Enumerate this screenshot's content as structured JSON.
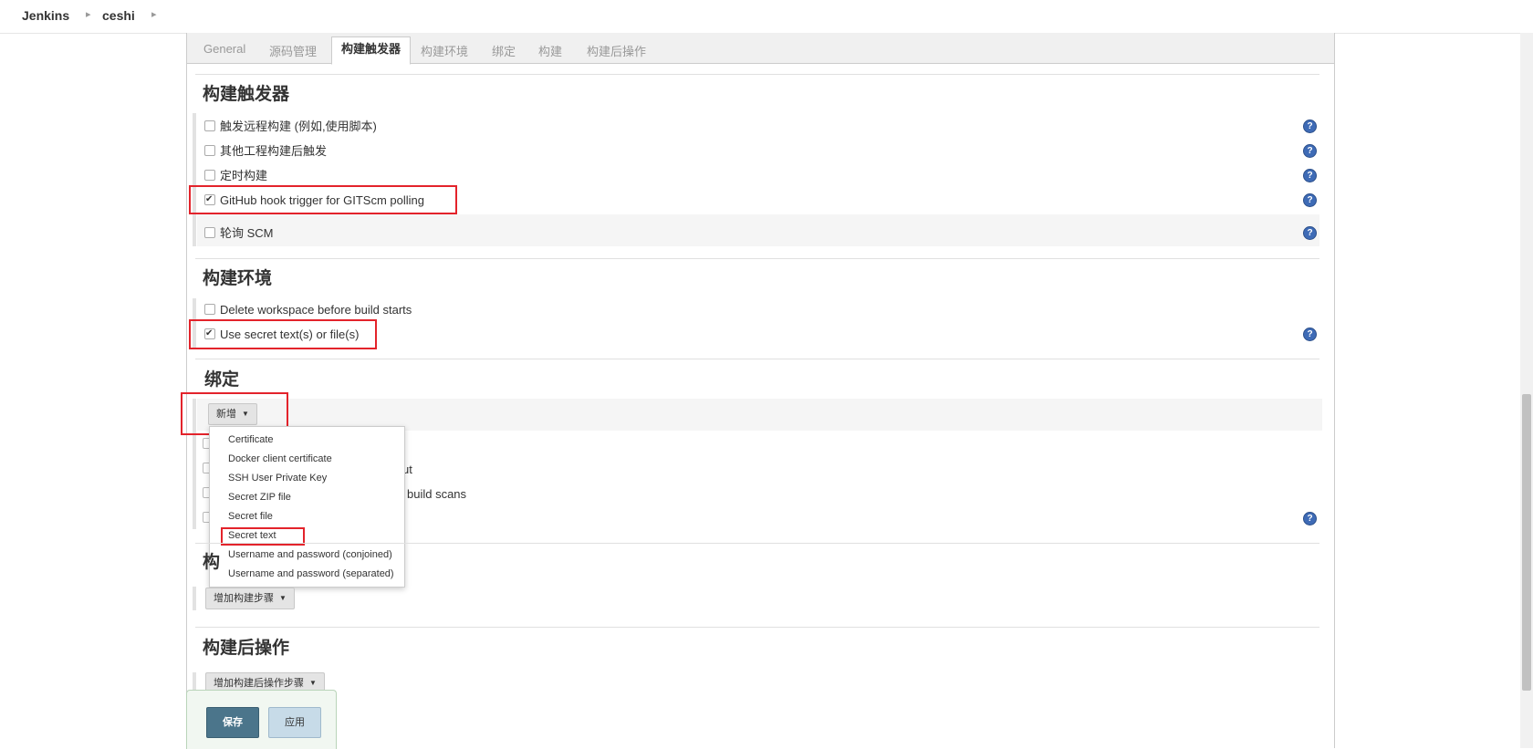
{
  "breadcrumb": {
    "root": "Jenkins",
    "job": "ceshi"
  },
  "tabs": [
    "General",
    "源码管理",
    "构建触发器",
    "构建环境",
    "绑定",
    "构建",
    "构建后操作"
  ],
  "active_tab": "构建触发器",
  "triggers": {
    "title": "构建触发器",
    "items": [
      {
        "label": "触发远程构建 (例如,使用脚本)",
        "checked": false
      },
      {
        "label": "其他工程构建后触发",
        "checked": false
      },
      {
        "label": "定时构建",
        "checked": false
      },
      {
        "label": "GitHub hook trigger for GITScm polling",
        "checked": true
      },
      {
        "label": "轮询 SCM",
        "checked": false
      }
    ]
  },
  "build_env": {
    "title": "构建环境",
    "items": [
      {
        "label": "Delete workspace before build starts",
        "checked": false
      },
      {
        "label": "Use secret text(s) or file(s)",
        "checked": true
      }
    ]
  },
  "bindings": {
    "title": "绑定",
    "add_button": "新增",
    "menu": [
      "Certificate",
      "Docker client certificate",
      "SSH User Private Key",
      "Secret ZIP file",
      "Secret file",
      "Secret text",
      "Username and password (conjoined)",
      "Username and password (separated)"
    ],
    "highlighted_item": "Secret text",
    "hidden_partial_1": "ut",
    "hidden_partial_2": "build scans"
  },
  "build": {
    "title_char": "构",
    "add_step": "增加构建步骤"
  },
  "post_build": {
    "title": "构建后操作",
    "add_step": "增加构建后操作步骤"
  },
  "footer": {
    "save": "保存",
    "apply": "应用"
  },
  "help_icon_glyph": "?",
  "colors": {
    "highlight_box": "#e3232b",
    "save_button": "#4b758b",
    "apply_button": "#c7dbe8",
    "help_icon": "#3e6bb6"
  }
}
